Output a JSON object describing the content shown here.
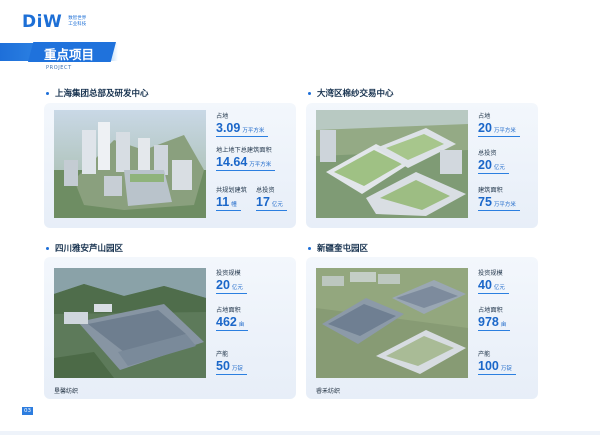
{
  "brand": {
    "mark": "DiW",
    "line1": "数智世界",
    "line2": "工业科技"
  },
  "section": {
    "title": "重点项目",
    "subtitle": "PROJECT"
  },
  "projects": [
    {
      "title": "上海集团总部及研发中心",
      "caption": "",
      "stats": [
        {
          "label": "占地",
          "value": "3.09",
          "unit": "万平方米"
        },
        {
          "label": "地上地下总建筑面积",
          "value": "14.64",
          "unit": "万平方米"
        },
        {
          "label": "共规划建筑",
          "value": "11",
          "unit": "幢"
        },
        {
          "label": "总投资",
          "value": "17",
          "unit": "亿元"
        }
      ]
    },
    {
      "title": "大湾区棉纱交易中心",
      "caption": "",
      "stats": [
        {
          "label": "占地",
          "value": "20",
          "unit": "万平方米"
        },
        {
          "label": "总投资",
          "value": "20",
          "unit": "亿元"
        },
        {
          "label": "建筑面积",
          "value": "75",
          "unit": "万平方米"
        }
      ]
    },
    {
      "title": "四川雅安芦山园区",
      "caption": "垦馨纺织",
      "stats": [
        {
          "label": "投资规模",
          "value": "20",
          "unit": "亿元"
        },
        {
          "label": "占地面积",
          "value": "462",
          "unit": "亩"
        },
        {
          "label": "产能",
          "value": "50",
          "unit": "万锭"
        }
      ]
    },
    {
      "title": "新疆奎屯园区",
      "caption": "睿禾纺织",
      "stats": [
        {
          "label": "投资规模",
          "value": "40",
          "unit": "亿元"
        },
        {
          "label": "占地面积",
          "value": "978",
          "unit": "亩"
        },
        {
          "label": "产能",
          "value": "100",
          "unit": "万锭"
        }
      ]
    }
  ],
  "page": {
    "number": "03"
  }
}
